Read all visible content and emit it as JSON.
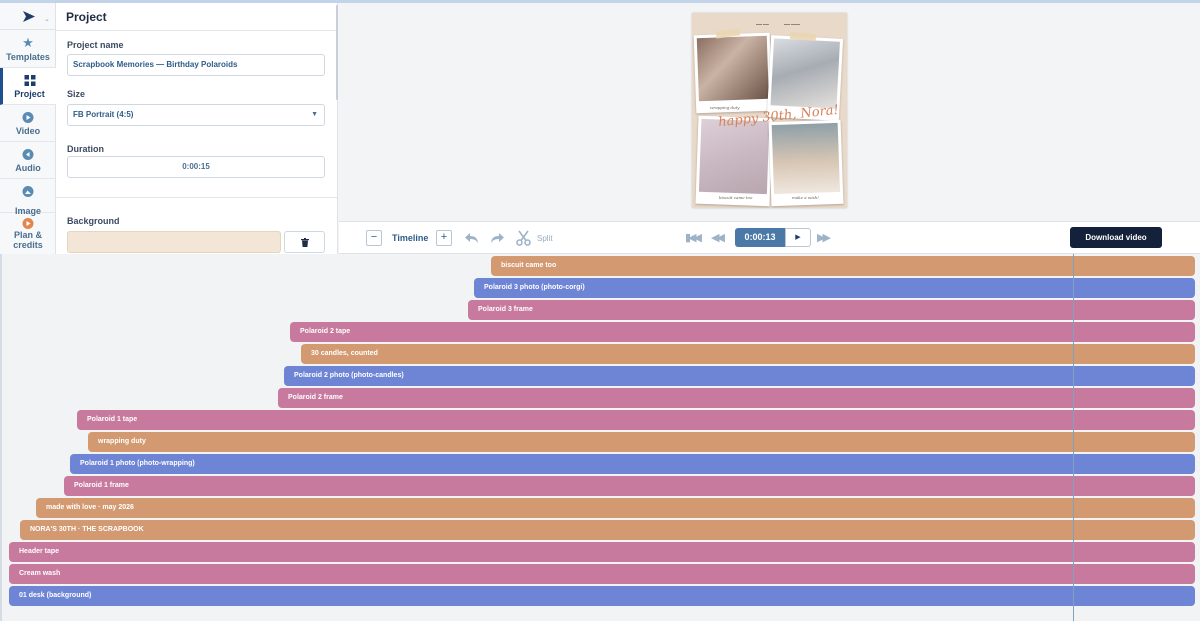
{
  "app": {
    "logo_icon": "play-arrow-logo-icon",
    "accent_color": "#1f3d6b"
  },
  "nav": {
    "items": [
      {
        "label": "Templates",
        "icon": "star-icon"
      },
      {
        "label": "Project",
        "icon": "grid-icon"
      },
      {
        "label": "Video",
        "icon": "play-circle-icon"
      },
      {
        "label": "Audio",
        "icon": "audio-icon"
      },
      {
        "label": "Image",
        "icon": "image-icon"
      },
      {
        "label": "Plan & credits",
        "icon": "plan-icon"
      }
    ],
    "active": "Project"
  },
  "panel": {
    "title": "Project",
    "project_name_label": "Project name",
    "project_name_value": "Scrapbook Memories — Birthday Polaroids",
    "size_label": "Size",
    "size_value": "FB Portrait (4:5)",
    "duration_label": "Duration",
    "duration_value": "0:00:15",
    "background_label": "Background",
    "background_color": "#f4e6d6"
  },
  "preview": {
    "caption_wrapping": "wrapping duty",
    "caption_happy": "happy 30th, Nora!",
    "caption_biscuit": "biscuit came too",
    "caption_wish": "make a wish!"
  },
  "toolbar": {
    "timeline_label": "Timeline",
    "zoom_out": "−",
    "zoom_in": "+",
    "split_label": "Split",
    "current_time": "0:00:13",
    "download_label": "Download video"
  },
  "timeline": {
    "playhead_time": "0:00:13",
    "tracks": [
      {
        "label": "biscuit came too",
        "color": "orange"
      },
      {
        "label": "Polaroid 3 photo (photo-corgi)",
        "color": "blue"
      },
      {
        "label": "Polaroid 3 frame",
        "color": "pink"
      },
      {
        "label": "Polaroid 2 tape",
        "color": "pink"
      },
      {
        "label": "30 candles, counted",
        "color": "orange"
      },
      {
        "label": "Polaroid 2 photo (photo-candles)",
        "color": "blue"
      },
      {
        "label": "Polaroid 2 frame",
        "color": "pink"
      },
      {
        "label": "Polaroid 1 tape",
        "color": "pink"
      },
      {
        "label": "wrapping duty",
        "color": "orange"
      },
      {
        "label": "Polaroid 1 photo (photo-wrapping)",
        "color": "blue"
      },
      {
        "label": "Polaroid 1 frame",
        "color": "pink"
      },
      {
        "label": "made with love  ·  may 2026",
        "color": "orange"
      },
      {
        "label": "NORA'S 30TH  ·  THE SCRAPBOOK",
        "color": "orange"
      },
      {
        "label": "Header tape",
        "color": "pink"
      },
      {
        "label": "Cream wash",
        "color": "pink"
      },
      {
        "label": "01 desk (background)",
        "color": "blue"
      }
    ]
  }
}
